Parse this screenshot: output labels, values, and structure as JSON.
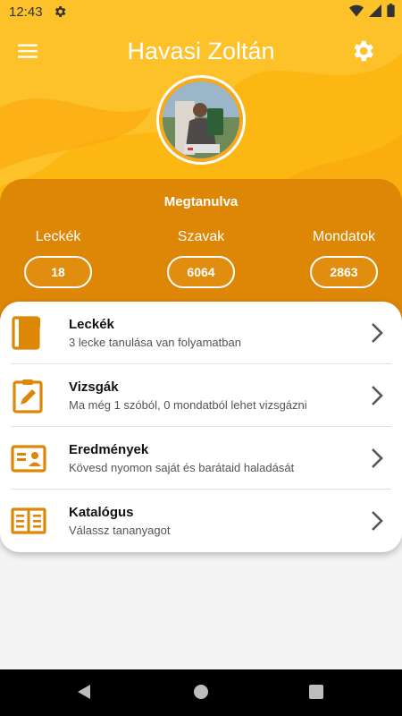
{
  "status_bar": {
    "time": "12:43",
    "icons": [
      "gear-icon",
      "wifi-icon",
      "signal-icon",
      "battery-icon"
    ]
  },
  "header": {
    "title": "Havasi Zoltán",
    "menu_icon": "menu-icon",
    "settings_icon": "settings-icon",
    "accent_color": "#fcb712"
  },
  "stats": {
    "title": "Megtanulva",
    "background_color": "#de8706",
    "items": [
      {
        "label": "Leckék",
        "value": "18"
      },
      {
        "label": "Szavak",
        "value": "6064"
      },
      {
        "label": "Mondatok",
        "value": "2863"
      }
    ]
  },
  "menu": {
    "icon_color": "#de8706",
    "items": [
      {
        "title": "Leckék",
        "subtitle": "3 lecke tanulása van folyamatban",
        "icon": "book-icon"
      },
      {
        "title": "Vizsgák",
        "subtitle": "Ma még 1 szóból, 0 mondatból lehet vizsgázni",
        "icon": "clipboard-edit-icon"
      },
      {
        "title": "Eredmények",
        "subtitle": "Kövesd nyomon saját és barátaid haladását",
        "icon": "id-card-icon"
      },
      {
        "title": "Katalógus",
        "subtitle": "Válassz tananyagot",
        "icon": "open-book-icon"
      }
    ]
  },
  "nav_bar": {
    "icons": [
      "back-icon",
      "home-icon",
      "recents-icon"
    ]
  }
}
